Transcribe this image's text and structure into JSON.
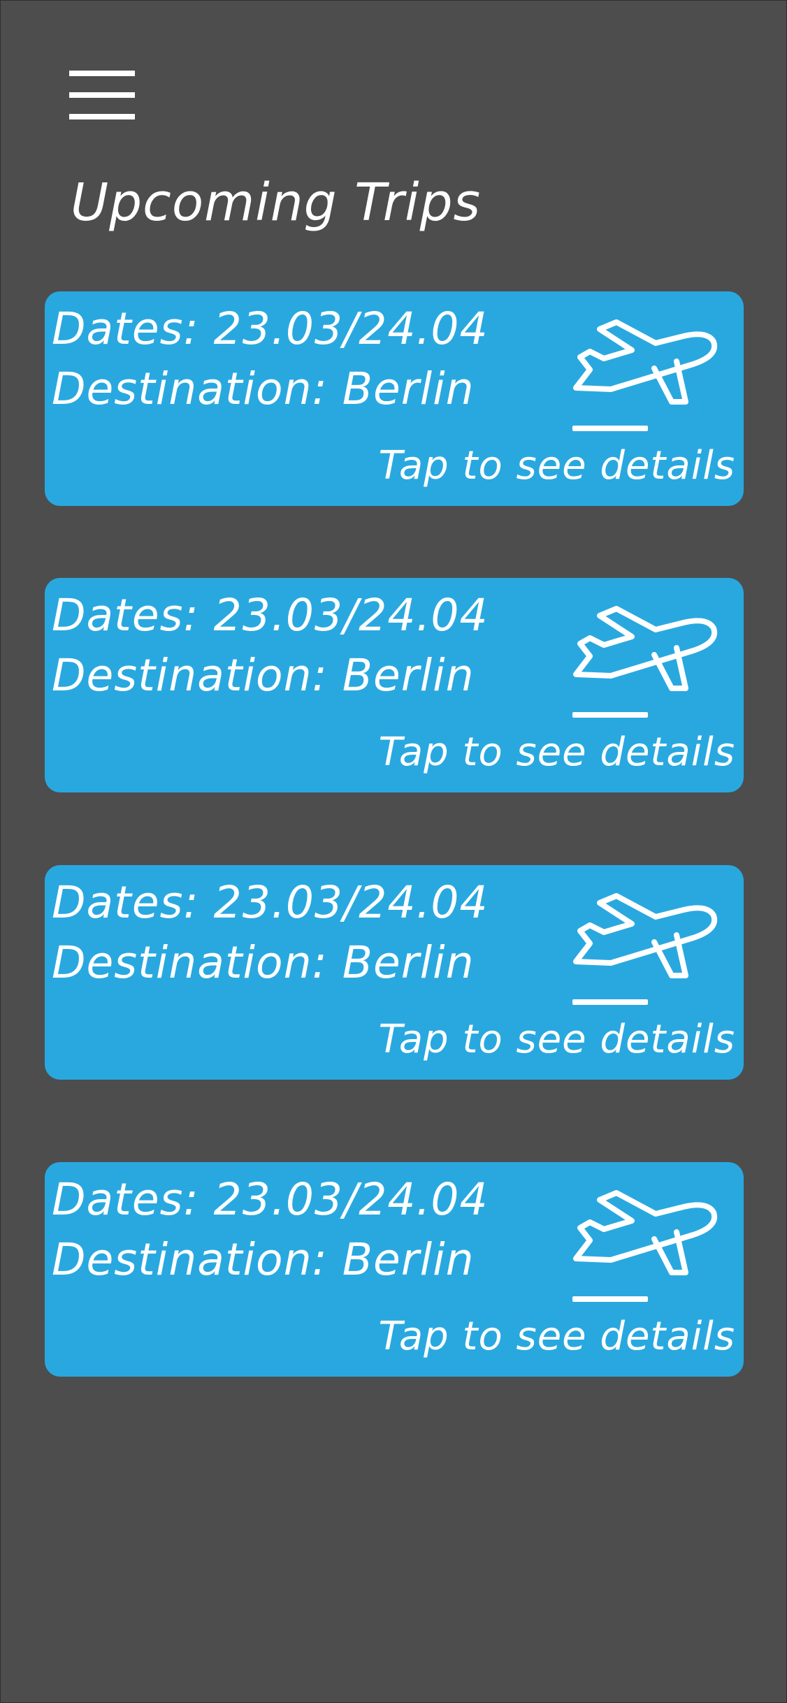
{
  "header": {
    "menu_icon": "hamburger-menu-icon",
    "title": "Upcoming Trips"
  },
  "trips": [
    {
      "dates": "Dates: 23.03/24.04",
      "destination": "Destination: Berlin",
      "cta": "Tap to see details",
      "icon": "airplane-departure-icon"
    },
    {
      "dates": "Dates: 23.03/24.04",
      "destination": "Destination: Berlin",
      "cta": "Tap to see details",
      "icon": "airplane-departure-icon"
    },
    {
      "dates": "Dates: 23.03/24.04",
      "destination": "Destination: Berlin",
      "cta": "Tap to see details",
      "icon": "airplane-departure-icon"
    },
    {
      "dates": "Dates: 23.03/24.04",
      "destination": "Destination: Berlin",
      "cta": "Tap to see details",
      "icon": "airplane-departure-icon"
    }
  ],
  "colors": {
    "background": "#4d4d4d",
    "card": "#29a8e0",
    "text": "#ffffff"
  }
}
